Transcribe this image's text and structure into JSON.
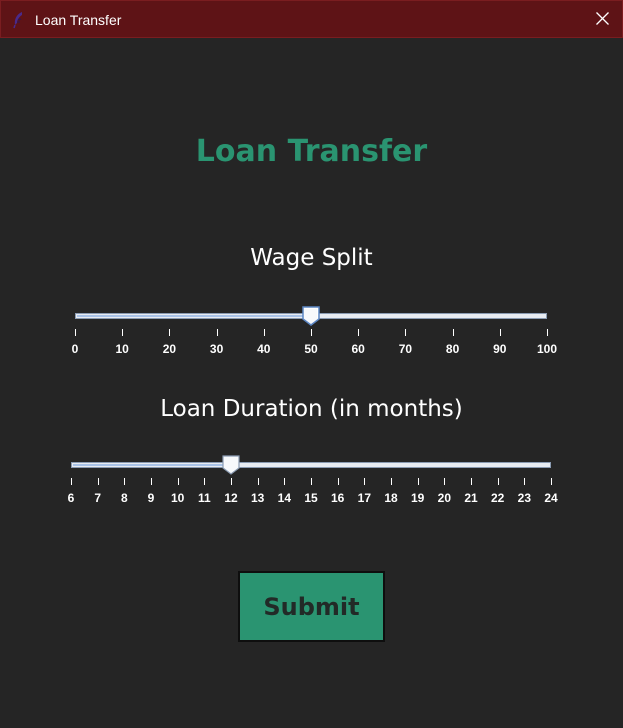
{
  "window": {
    "title": "Loan Transfer",
    "icon": "feather-pen-icon",
    "titlebar_color": "#5e1316"
  },
  "heading": "Loan Transfer",
  "wage_split": {
    "label": "Wage Split",
    "min": 0,
    "max": 100,
    "value": 50,
    "tick_labels": [
      "0",
      "10",
      "20",
      "30",
      "40",
      "50",
      "60",
      "70",
      "80",
      "90",
      "100"
    ]
  },
  "loan_duration": {
    "label": "Loan Duration (in months)",
    "min": 6,
    "max": 24,
    "value": 12,
    "tick_labels": [
      "6",
      "7",
      "8",
      "9",
      "10",
      "11",
      "12",
      "13",
      "14",
      "15",
      "16",
      "17",
      "18",
      "19",
      "20",
      "21",
      "22",
      "23",
      "24"
    ]
  },
  "submit_label": "Submit",
  "colors": {
    "accent": "#2a9471",
    "background": "#252525"
  }
}
